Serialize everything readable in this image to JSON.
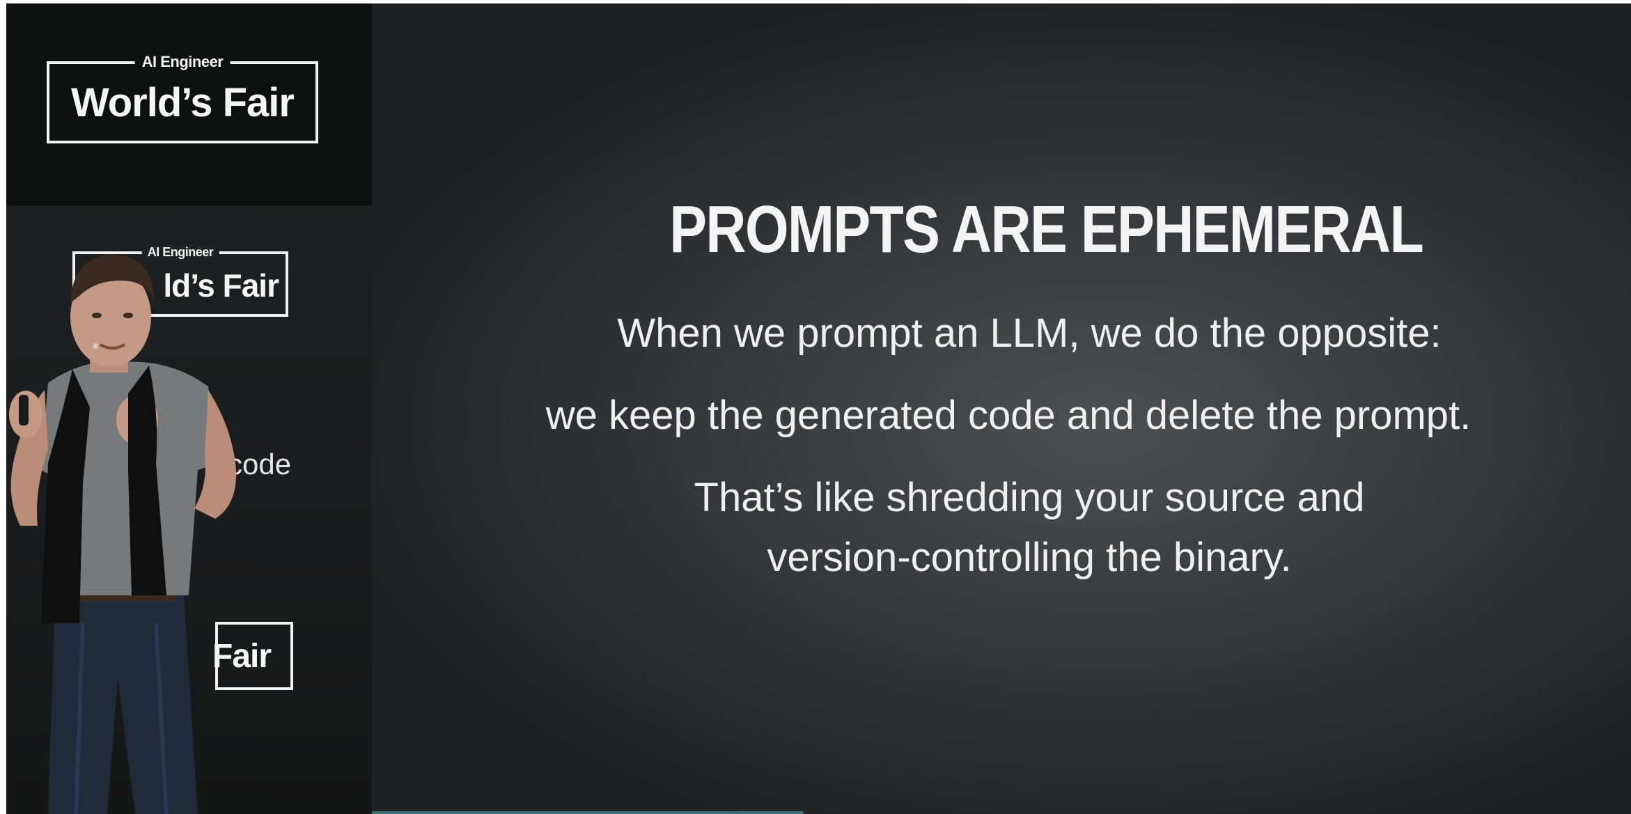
{
  "broadcast": {
    "logo": {
      "small": "AI Engineer",
      "big": "World’s Fair"
    },
    "backdrop": {
      "banner_small": "AI Engineer",
      "banner_big": "ld’s Fair",
      "code_text": "code",
      "banner_big_2": "Fair"
    }
  },
  "slide": {
    "title": "PROMPTS ARE EPHEMERAL",
    "lines": [
      "When we prompt an LLM, we do the opposite:",
      "we keep the generated code and delete the prompt.",
      "That’s like shredding your source and",
      "version-controlling the binary."
    ]
  },
  "colors": {
    "slide_text": "#f0f0f0",
    "logo_text": "#f5f5f5",
    "background_dark": "#1d1f20"
  }
}
